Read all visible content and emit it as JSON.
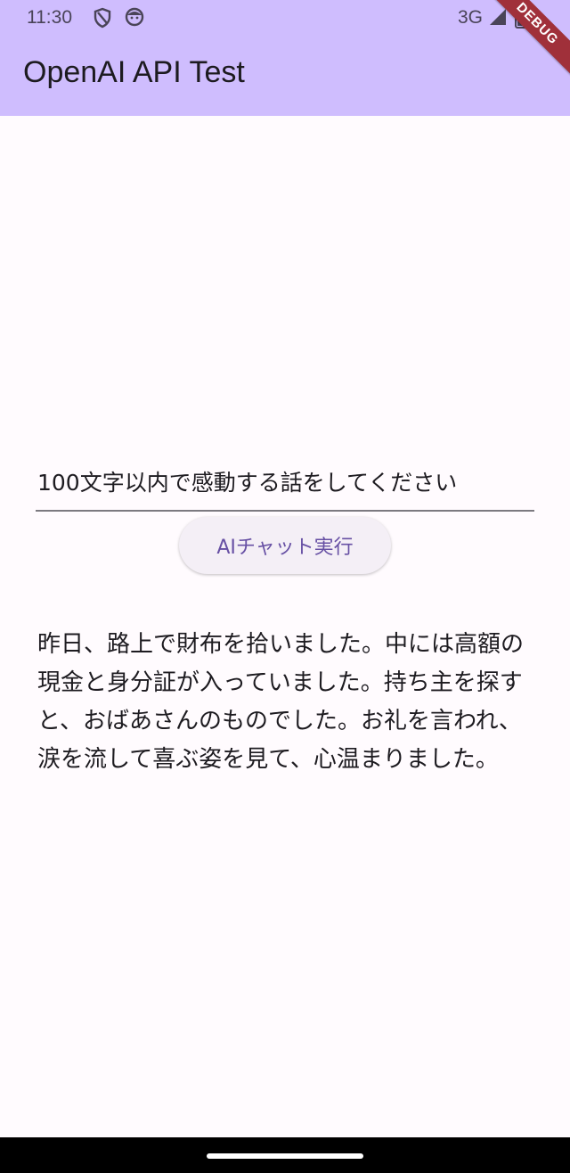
{
  "status_bar": {
    "time": "11:30",
    "network": "3G",
    "icons": [
      "shield-icon",
      "face-icon",
      "signal-icon",
      "battery-icon"
    ]
  },
  "debug_banner": "DEBUG",
  "app_bar": {
    "title": "OpenAI API Test",
    "color": "#cfbdfe"
  },
  "prompt": {
    "value": "100文字以内で感動する話をしてください"
  },
  "run_button": {
    "label": "AIチャット実行",
    "color": "#6750a4"
  },
  "result": {
    "text": "昨日、路上で財布を拾いました。中には高額の現金と身分証が入っていました。持ち主を探すと、おばあさんのものでした。お礼を言われ、涙を流して喜ぶ姿を見て、心温まりました。"
  }
}
